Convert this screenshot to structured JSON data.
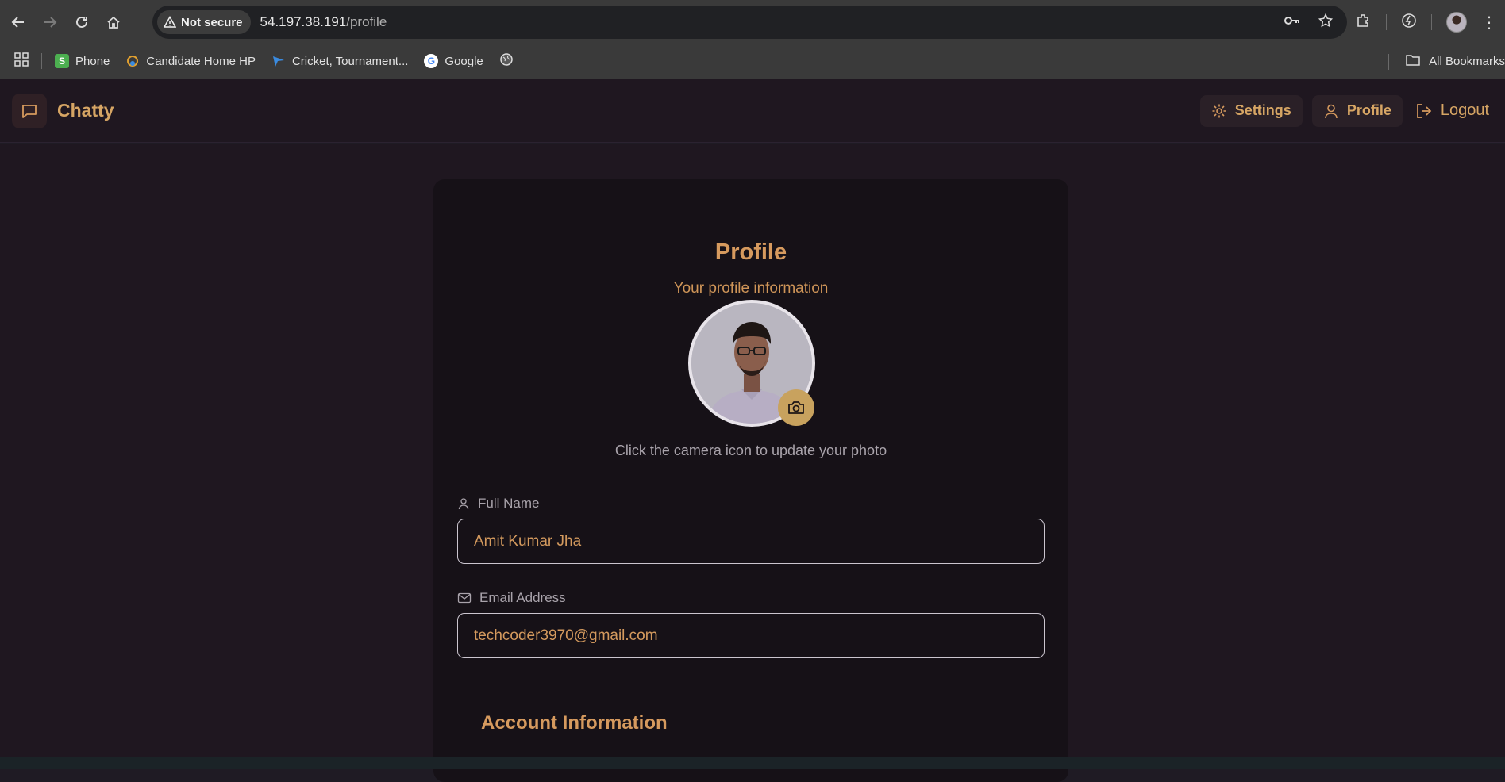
{
  "browser": {
    "security_label": "Not secure",
    "url_host": "54.197.38.191",
    "url_path": "/profile",
    "bookmarks": [
      {
        "label": "Phone",
        "icon": "phone-bookmark-icon",
        "color": "#4caf50"
      },
      {
        "label": "Candidate Home HP",
        "icon": "hp-bookmark-icon",
        "color": "#e0a030"
      },
      {
        "label": "Cricket, Tournament...",
        "icon": "cricket-bookmark-icon",
        "color": "#3a8be0"
      },
      {
        "label": "Google",
        "icon": "google-icon",
        "color": "#ffffff"
      }
    ],
    "all_bookmarks_label": "All Bookmarks"
  },
  "app": {
    "name": "Chatty",
    "nav": {
      "settings_label": "Settings",
      "profile_label": "Profile",
      "logout_label": "Logout"
    }
  },
  "profile": {
    "title": "Profile",
    "subtitle": "Your profile information",
    "photo_hint": "Click the camera icon to update your photo",
    "full_name_label": "Full Name",
    "full_name_value": "Amit Kumar Jha",
    "email_label": "Email Address",
    "email_value": "techcoder3970@gmail.com",
    "account_section_title": "Account Information"
  },
  "colors": {
    "accent": "#d69a5e",
    "background": "#1f1720",
    "card": "#161117",
    "camera_button": "#c8a25e"
  }
}
